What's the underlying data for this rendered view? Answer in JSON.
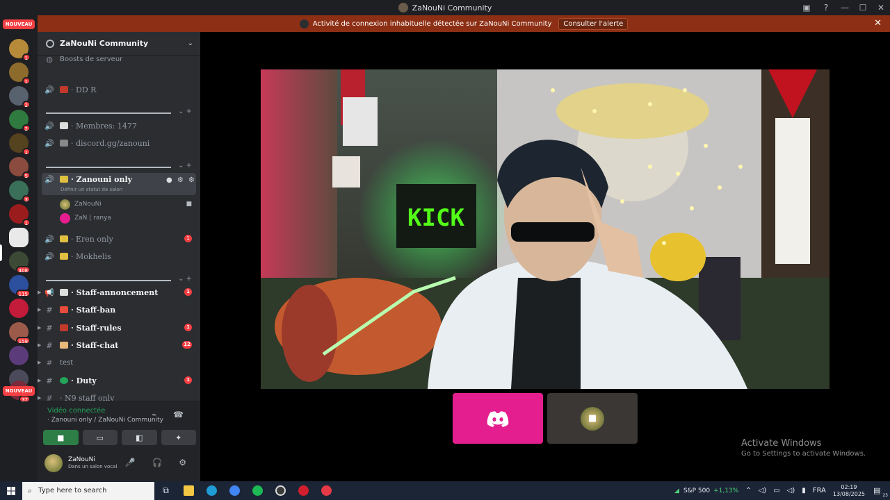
{
  "window": {
    "title": "ZaNouNi Community"
  },
  "alert": {
    "text": "Activité de connexion inhabituelle détectée sur ZaNouNi Community",
    "button": "Consulter l'alerte"
  },
  "rail": {
    "new_badge": "NOUVEAU",
    "badges": [
      "1",
      "1",
      "2",
      "2",
      "1",
      "5",
      "3",
      "1",
      "408",
      "115",
      "159",
      "112",
      "37"
    ]
  },
  "guild": {
    "name": "ZaNouNi Community",
    "boosts": "Boosts de serveur"
  },
  "channels": {
    "dd_r": "· DD R",
    "membres": "· Membres: 1477",
    "invite": "· discord.gg/zanouni",
    "zanouni_only": "· Zanouni only",
    "zanouni_status": "Définir un statut de salon",
    "voice_user_1": "ZaNouNi",
    "voice_user_2": "ZaN | ranya",
    "eren_only": "· Eren only",
    "eren_badge": "1",
    "mokhelis": "· Mokhelis",
    "staff_annonce": "· Staff-annoncement",
    "staff_annonce_badge": "1",
    "staff_ban": "· Staff-ban",
    "staff_rules": "· Staff-rules",
    "staff_rules_badge": "1",
    "staff_chat": "· Staff-chat",
    "staff_chat_badge": "12",
    "test": "test",
    "duty": "· Duty",
    "duty_badge": "1",
    "n9": "· N9 staff only"
  },
  "voice_panel": {
    "status": "Vidéo connectée",
    "channel": "· Zanouni only / ZaNouNi Community"
  },
  "user_panel": {
    "name": "ZaNouNi",
    "sub": "Dans un salon vocal"
  },
  "stage": {
    "camera_sign": "KICK"
  },
  "watermark": {
    "line1": "Activate Windows",
    "line2": "Go to Settings to activate Windows."
  },
  "taskbar": {
    "search_placeholder": "Type here to search",
    "stock_name": "S&P 500",
    "stock_change": "+1,13%",
    "lang": "FRA",
    "time": "02:19",
    "date": "13/08/2025",
    "notif_count": "23"
  },
  "colors": {
    "discord_pink": "#e41e8f",
    "alert": "#8c2f14",
    "green": "#23a55a",
    "badge_red": "#f23f43"
  }
}
